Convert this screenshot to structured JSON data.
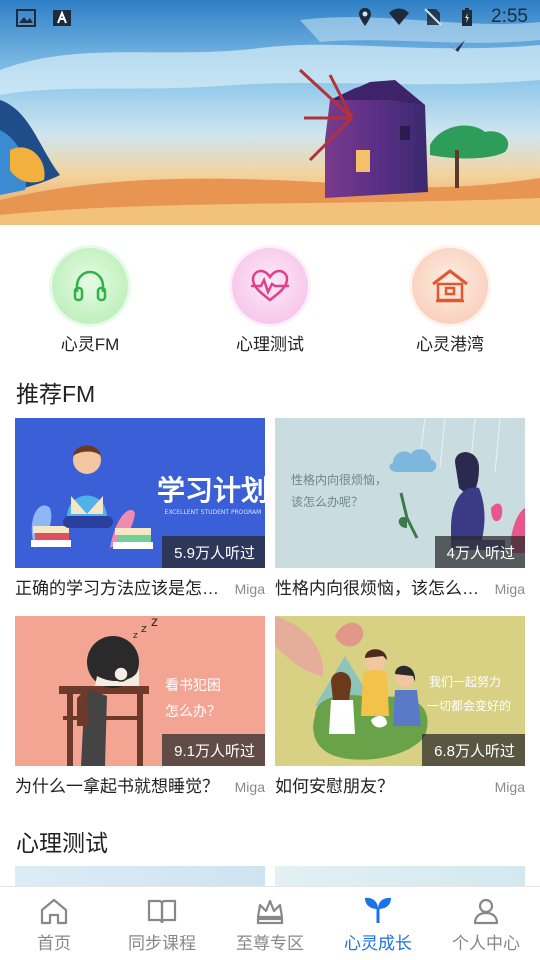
{
  "status_bar": {
    "time": "2:55"
  },
  "quick_entries": [
    {
      "label": "心灵FM",
      "icon": "headphones-icon",
      "color": "#2fb24a"
    },
    {
      "label": "心理测试",
      "icon": "heart-pulse-icon",
      "color": "#e0408a"
    },
    {
      "label": "心灵港湾",
      "icon": "harbor-house-icon",
      "color": "#e4572e"
    }
  ],
  "sections": {
    "fm_title": "推荐FM",
    "test_title": "心理测试"
  },
  "fm_cards": [
    {
      "title": "正确的学习方法应该是怎样的？",
      "author": "Miga",
      "listens": "5.9万人听过",
      "thumb_text": "学习计划",
      "thumb_sub": "EXCELLENT STUDENT PROGRAM"
    },
    {
      "title": "性格内向很烦恼，该怎么办呢？",
      "author": "Miga",
      "listens": "4万人听过",
      "thumb_text": "性格内向很烦恼，该怎么办呢？"
    },
    {
      "title": "为什么一拿起书就想睡觉？",
      "author": "Miga",
      "listens": "9.1万人听过",
      "thumb_text": "看书犯困 怎么办？"
    },
    {
      "title": "如何安慰朋友？",
      "author": "Miga",
      "listens": "6.8万人听过",
      "thumb_text": "我们一起努力 一切都会变好的"
    }
  ],
  "tab_bar": {
    "active_index": 3,
    "accent": "#1a73e8",
    "tabs": [
      {
        "label": "首页",
        "icon": "home-icon"
      },
      {
        "label": "同步课程",
        "icon": "book-icon"
      },
      {
        "label": "至尊专区",
        "icon": "crown-icon"
      },
      {
        "label": "心灵成长",
        "icon": "sprout-icon"
      },
      {
        "label": "个人中心",
        "icon": "person-icon"
      }
    ]
  }
}
